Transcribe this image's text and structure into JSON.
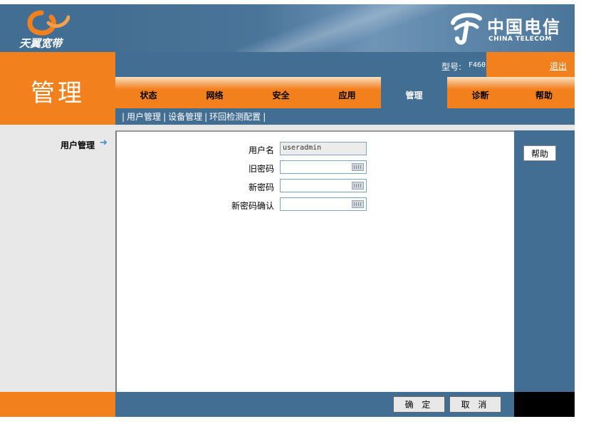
{
  "header": {
    "brand_logo_text": "天翼宽带",
    "ct_cn": "中国电信",
    "ct_en": "CHINA TELECOM"
  },
  "page_title": "管理",
  "info": {
    "model_label": "型号:",
    "model_value": "F460",
    "logout": "退出"
  },
  "tabs": [
    {
      "label": "状态"
    },
    {
      "label": "网络"
    },
    {
      "label": "安全"
    },
    {
      "label": "应用"
    },
    {
      "label": "管理",
      "active": true
    },
    {
      "label": "诊断"
    },
    {
      "label": "帮助"
    }
  ],
  "subnav": [
    "用户管理",
    "设备管理",
    "环回检测配置"
  ],
  "sidebar": {
    "current": "用户管理"
  },
  "form": {
    "username_label": "用户名",
    "username_value": "useradmin",
    "old_password_label": "旧密码",
    "new_password_label": "新密码",
    "confirm_password_label": "新密码确认"
  },
  "right_panel": {
    "help_button": "帮助"
  },
  "footer": {
    "confirm": "确 定",
    "cancel": "取 消"
  },
  "colors": {
    "orange": "#f2801c",
    "blue": "#436e93",
    "sidebar_gray": "#e8e8e8"
  }
}
